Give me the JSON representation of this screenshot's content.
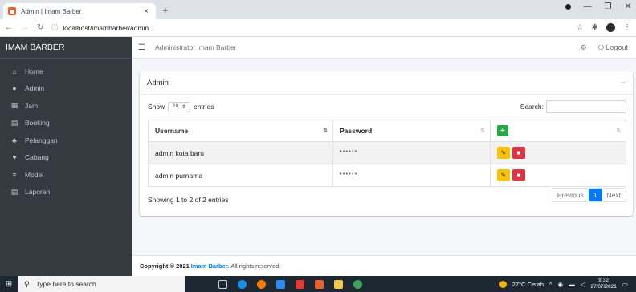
{
  "browser": {
    "tab_title": "Admin | Imam Barber",
    "tab_close": "×",
    "new_tab": "+",
    "url": "localhost/imambarber/admin"
  },
  "sidebar": {
    "brand": "IMAM BARBER",
    "items": [
      {
        "label": "Home",
        "icon": "home-icon",
        "glyph": "⌂"
      },
      {
        "label": "Admin",
        "icon": "user-icon",
        "glyph": "●"
      },
      {
        "label": "Jam",
        "icon": "table-icon",
        "glyph": "▦"
      },
      {
        "label": "Booking",
        "icon": "list-icon",
        "glyph": "▤"
      },
      {
        "label": "Pelanggan",
        "icon": "users-icon",
        "glyph": "♣"
      },
      {
        "label": "Cabang",
        "icon": "location-icon",
        "glyph": "♥"
      },
      {
        "label": "Model",
        "icon": "align-icon",
        "glyph": "≡"
      },
      {
        "label": "Laporan",
        "icon": "report-icon",
        "glyph": "▤"
      }
    ]
  },
  "navbar": {
    "title": "Administrator Imam Barber",
    "logout": "Logout"
  },
  "card": {
    "title": "Admin",
    "show": "Show",
    "length_value": "10",
    "entries": "entries",
    "search_label": "Search:",
    "columns": [
      "Username",
      "Password"
    ],
    "add_label": "+",
    "rows": [
      {
        "username": "admin kota baru",
        "password": "******"
      },
      {
        "username": "admin purnama",
        "password": "******"
      }
    ],
    "info": "Showing 1 to 2 of 2 entries",
    "pager": {
      "previous": "Previous",
      "current": "1",
      "next": "Next"
    }
  },
  "footer": {
    "prefix": "Copyright © 2021",
    "brand": "Imam Barber.",
    "suffix": "All rights reserved."
  },
  "taskbar": {
    "search_placeholder": "Type here to search",
    "weather": "27°C  Cerah",
    "time": "9:32",
    "date": "27/07/2021"
  },
  "colors": {
    "sidebar": "#343a40",
    "primary": "#007bff",
    "success": "#28a745",
    "warning": "#ffc107",
    "danger": "#dc3545"
  }
}
